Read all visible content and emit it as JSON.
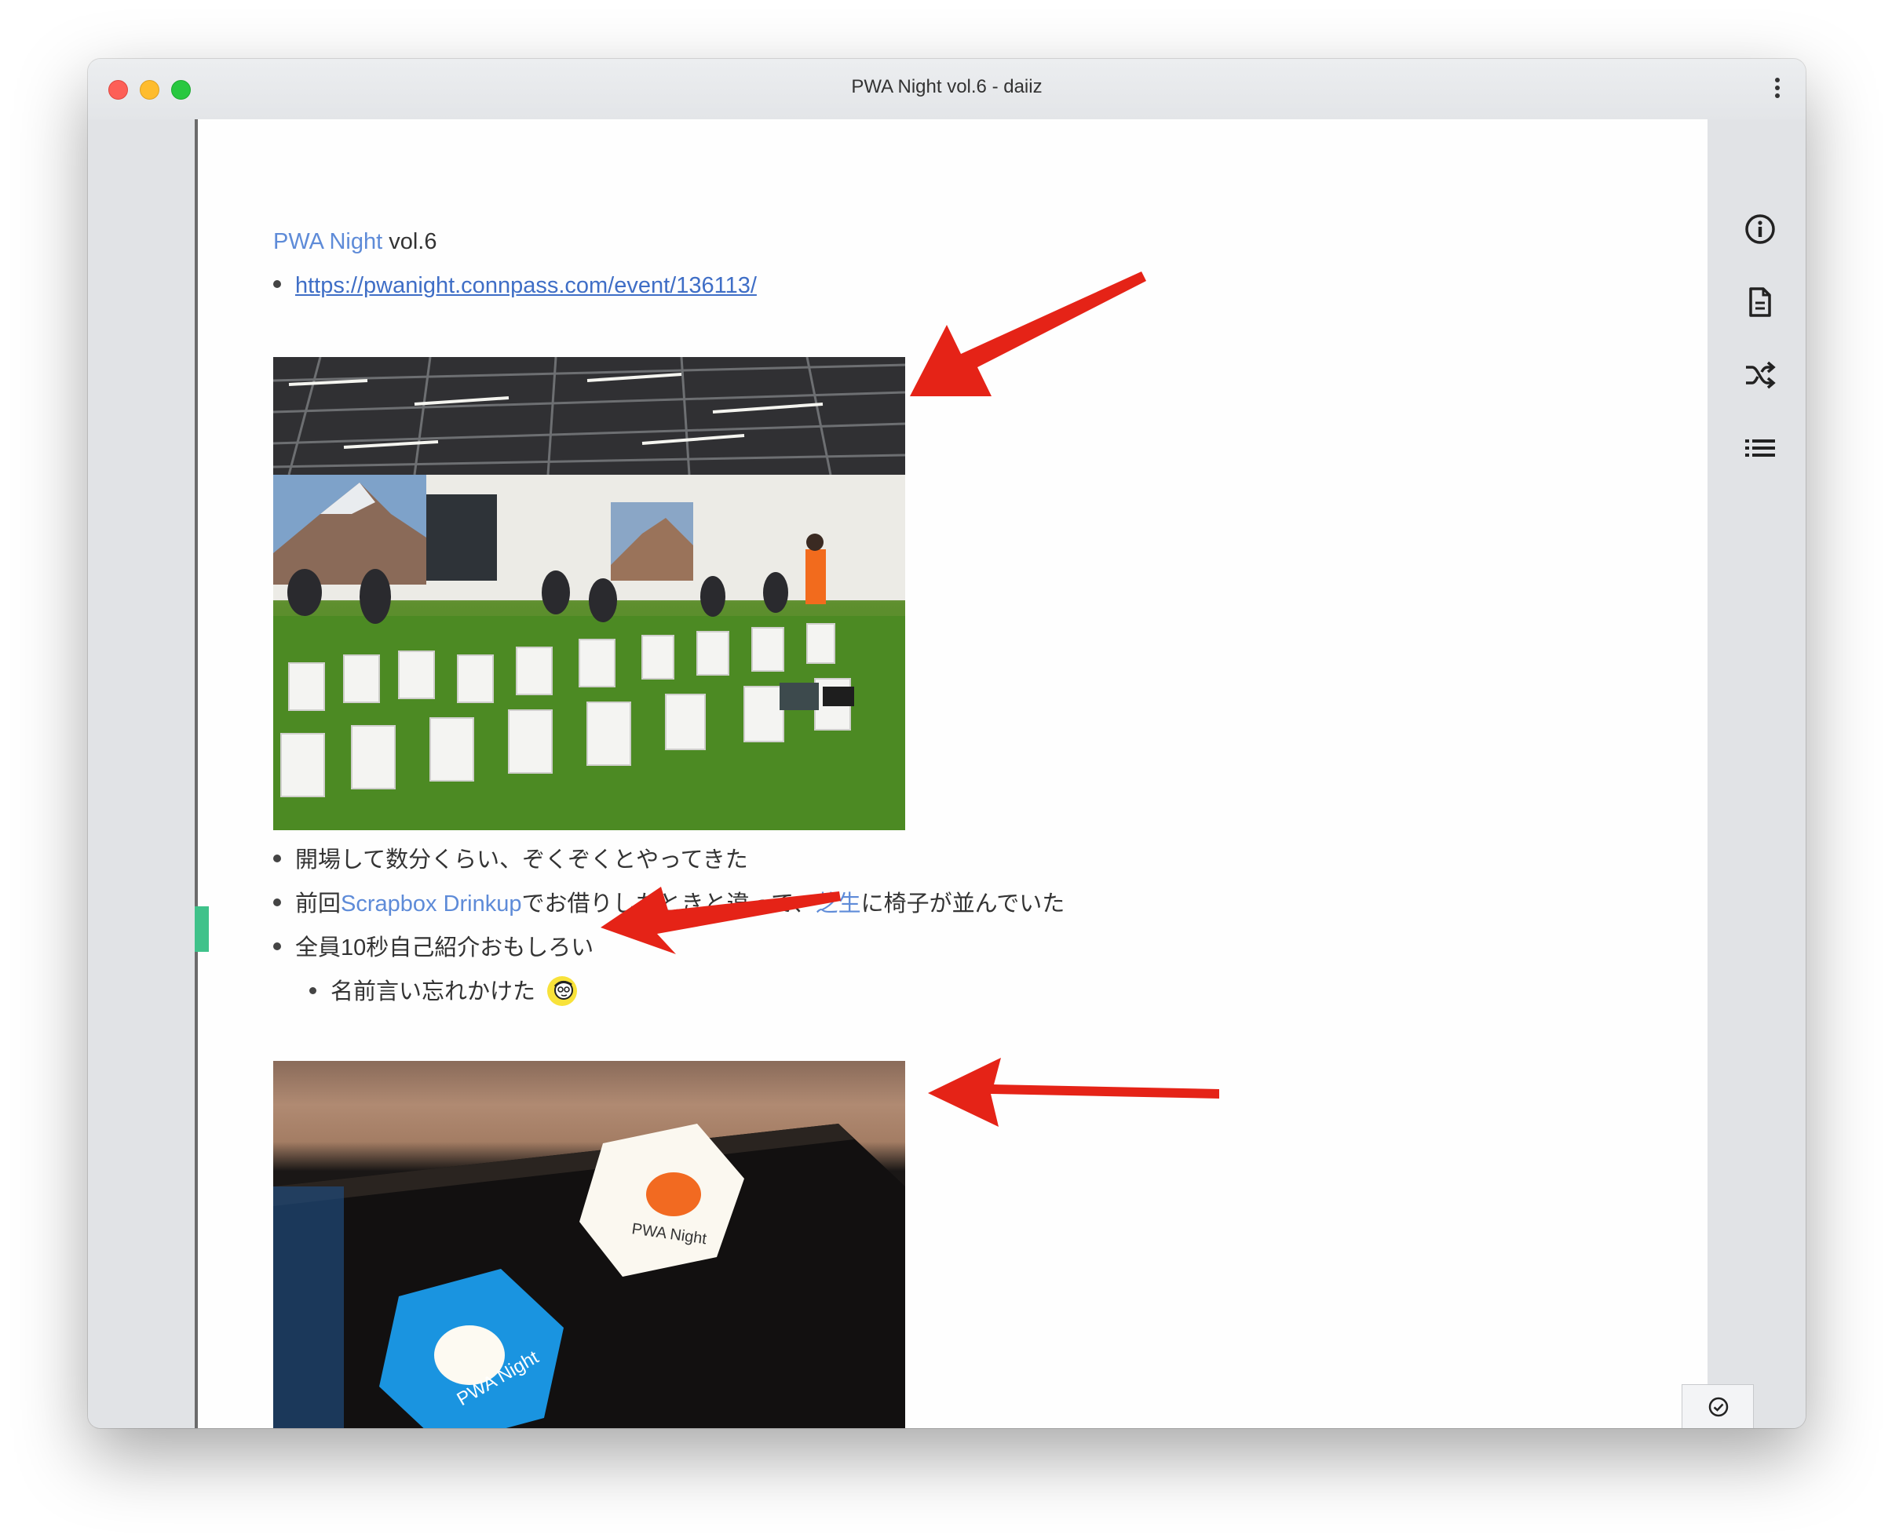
{
  "window": {
    "title": "PWA Night vol.6 - daiiz"
  },
  "header": {
    "link_text": "PWA Night",
    "suffix": " vol.6"
  },
  "event_url": "https://pwanight.connpass.com/event/136113/",
  "bullets": {
    "b1": "開場して数分くらい、ぞくぞくとやってきた",
    "b2": {
      "prefix": "前回",
      "link1": "Scrapbox Drinkup",
      "middle": "でお借りしたときと違って、",
      "link2": "芝生",
      "suffix": "に椅子が並んでいた"
    },
    "b3": "全員10秒自己紹介おもしろい",
    "b4": "名前言い忘れかけた"
  },
  "stickers": {
    "blue": "PWA Night",
    "white": "PWA Night"
  },
  "colors": {
    "link": "#5e8bd8",
    "arrow": "#e52317",
    "cursor": "#3fc28a",
    "sticker_blue": "#1a94e0",
    "sticker_orange": "#f26a21"
  },
  "sidebar_icons": [
    "info-icon",
    "page-icon",
    "shuffle-icon",
    "list-icon"
  ],
  "status_icon": "check-circle-icon"
}
